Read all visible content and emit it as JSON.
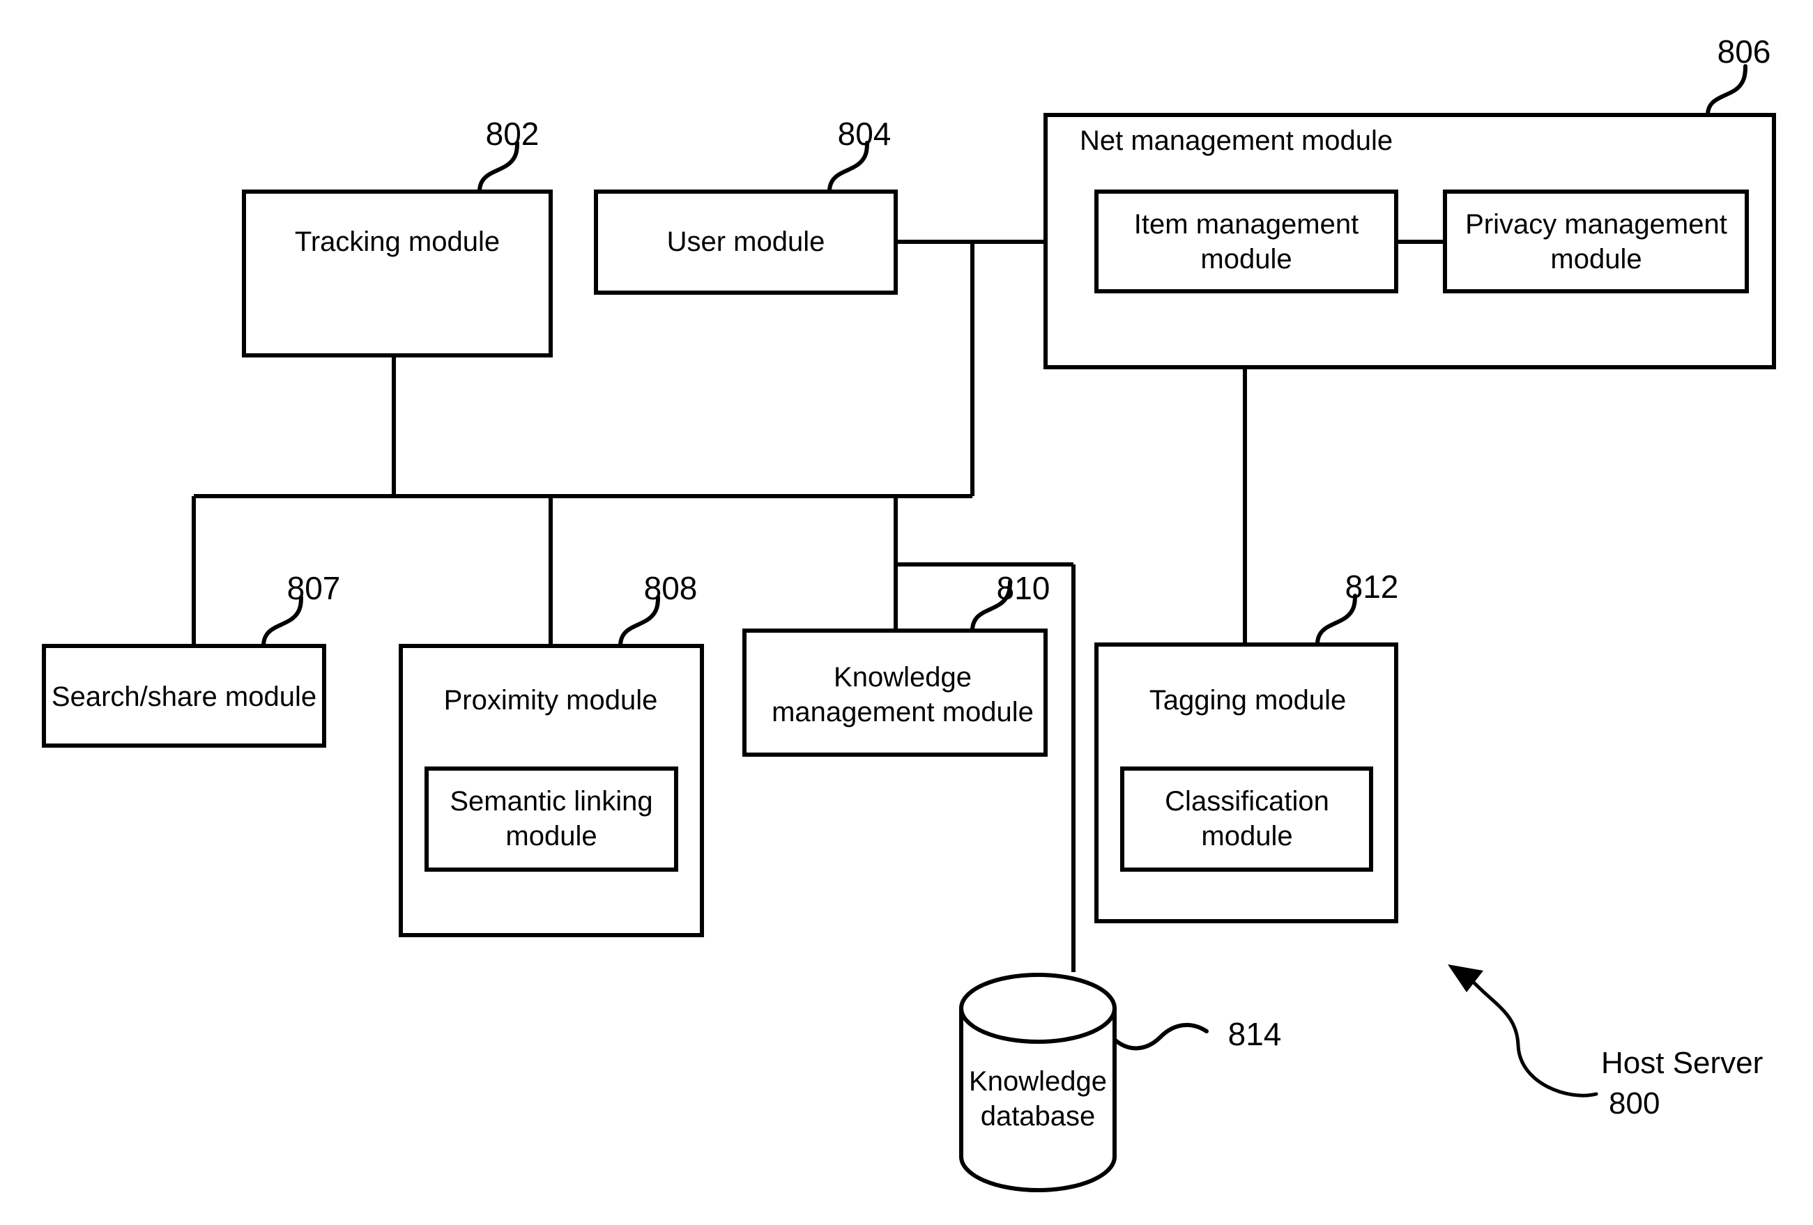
{
  "figure": {
    "title_annotation": {
      "name_line": "Host Server",
      "number_line": "800"
    }
  },
  "modules": {
    "tracking": {
      "label": "Tracking module",
      "ref": "802"
    },
    "user": {
      "label": "User module",
      "ref": "804"
    },
    "net_management": {
      "label": "Net management module",
      "ref": "806"
    },
    "item_management": {
      "label_line1": "Item management",
      "label_line2": "module"
    },
    "privacy_management": {
      "label_line1": "Privacy management",
      "label_line2": "module"
    },
    "search_share": {
      "label": "Search/share module",
      "ref": "807"
    },
    "proximity": {
      "label": "Proximity module",
      "ref": "808"
    },
    "semantic_linking": {
      "label_line1": "Semantic linking",
      "label_line2": "module"
    },
    "knowledge_management": {
      "label_line1": "Knowledge",
      "label_line2": "management module",
      "ref": "810"
    },
    "tagging": {
      "label": "Tagging module",
      "ref": "812"
    },
    "classification": {
      "label_line1": "Classification",
      "label_line2": "module"
    },
    "knowledge_database": {
      "label_line1": "Knowledge",
      "label_line2": "database",
      "ref": "814"
    }
  },
  "colors": {
    "stroke": "#000000",
    "background": "#ffffff"
  }
}
